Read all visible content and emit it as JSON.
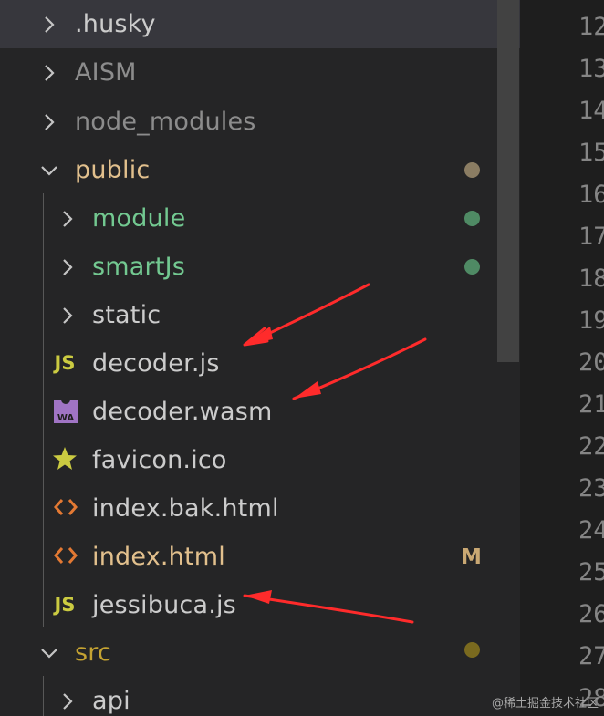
{
  "explorer": {
    "items": [
      {
        "label": "husky_label",
        "text": ".husky"
      },
      {
        "label": "AISM"
      },
      {
        "label": "node_modules"
      },
      {
        "label": "public"
      },
      {
        "label": "module"
      },
      {
        "label": "smartJs"
      },
      {
        "label": "static"
      },
      {
        "label": "decoder.js",
        "icon": "JS"
      },
      {
        "label": "decoder.wasm",
        "icon": "WA"
      },
      {
        "label": "favicon.ico"
      },
      {
        "label": "index.bak.html"
      },
      {
        "label": "index.html",
        "badge": "M"
      },
      {
        "label": "jessibuca.js",
        "icon": "JS"
      },
      {
        "label": "src"
      },
      {
        "label": "api"
      }
    ]
  },
  "labels": {
    "husky": ".husky",
    "aism": "AISM",
    "node_modules": "node_modules",
    "public": "public",
    "module": "module",
    "smartjs": "smartJs",
    "static": "static",
    "decoder_js": "decoder.js",
    "decoder_wasm": "decoder.wasm",
    "favicon": "favicon.ico",
    "index_bak": "index.bak.html",
    "index_html": "index.html",
    "index_html_badge": "M",
    "jessibuca": "jessibuca.js",
    "src": "src",
    "api": "api",
    "js_icon_text": "JS",
    "wasm_icon_text": "WA"
  },
  "line_numbers": [
    "12",
    "13",
    "14",
    "15",
    "16",
    "17",
    "18",
    "19",
    "20",
    "21",
    "22",
    "23",
    "24",
    "25",
    "26",
    "27",
    "28"
  ],
  "watermark": "@稀土掘金技术社区",
  "colors": {
    "default_text": "#cccccc",
    "ignored_text": "#8c8c8c",
    "modified_folder": "#e2c08d",
    "untracked_green": "#73c991",
    "src_yellow": "#c5a332",
    "js_icon": "#cbcb41",
    "wasm_icon": "#a074c4",
    "html_icon": "#e37933",
    "favicon_star": "#cbcb41",
    "arrow": "#ff3333"
  }
}
